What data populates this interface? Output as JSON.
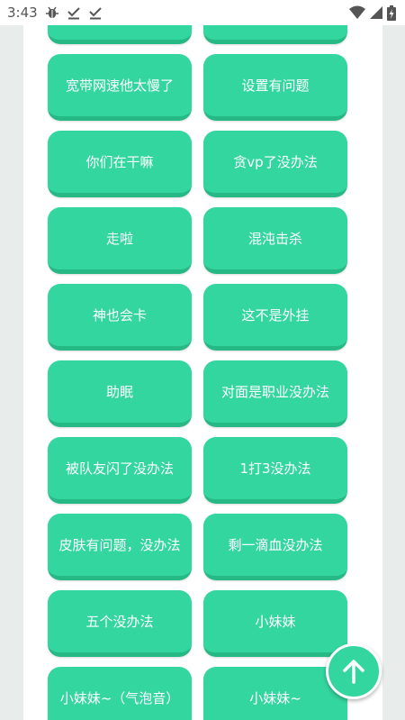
{
  "status_bar": {
    "time": "3:43",
    "notification_icons": [
      "debug-bug-icon",
      "download-done-icon",
      "download-done-icon"
    ],
    "system_icons": [
      "wifi-icon",
      "cellular-signal-icon",
      "battery-charging-icon"
    ]
  },
  "buttons": [
    {
      "label": ""
    },
    {
      "label": ""
    },
    {
      "label": "宽带网速他太慢了"
    },
    {
      "label": "设置有问题"
    },
    {
      "label": "你们在干嘛"
    },
    {
      "label": "贪vp了没办法"
    },
    {
      "label": "走啦"
    },
    {
      "label": "混沌击杀"
    },
    {
      "label": "神也会卡"
    },
    {
      "label": "这不是外挂"
    },
    {
      "label": "助眠"
    },
    {
      "label": "对面是职业没办法"
    },
    {
      "label": "被队友闪了没办法"
    },
    {
      "label": "1打3没办法"
    },
    {
      "label": "皮肤有问题，没办法"
    },
    {
      "label": "剩一滴血没办法"
    },
    {
      "label": "五个没办法"
    },
    {
      "label": "小妹妹"
    },
    {
      "label": "小妹妹~（气泡音）"
    },
    {
      "label": "小妹妹~"
    }
  ],
  "fab": {
    "icon": "arrow-up-icon"
  },
  "colors": {
    "button": "#34d6a0",
    "button_edge": "#27b985",
    "panel": "#ffffff",
    "background": "#e8eceb"
  }
}
